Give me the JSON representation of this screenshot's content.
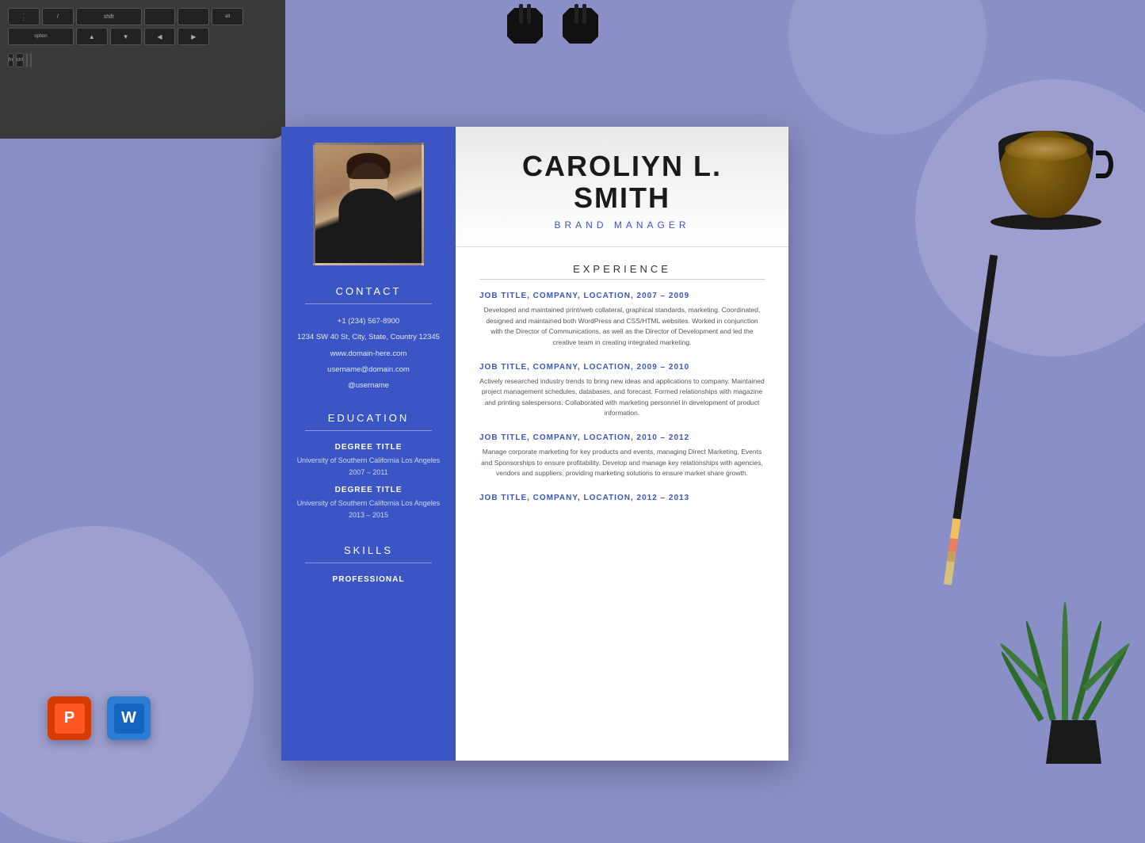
{
  "background": {
    "color": "#8b8fc7"
  },
  "resume": {
    "person": {
      "name_line1": "CAROLIYN L.",
      "name_line2": "SMITH",
      "title": "BRAND MANAGER",
      "photo_alt": "Caroliyn L. Smith profile photo"
    },
    "left_sidebar": {
      "contact_section": {
        "title": "CONTACT",
        "phone": "+1 (234) 567-8900",
        "address": "1234 SW 40 St, City, State, Country 12345",
        "website": "www.domain-here.com",
        "email": "username@domain.com",
        "social": "@username"
      },
      "education_section": {
        "title": "EDUCATION",
        "degrees": [
          {
            "degree": "DEGREE TITLE",
            "university": "University of Southern California Los Angeles",
            "years": "2007 – 2011"
          },
          {
            "degree": "DEGREE TITLE",
            "university": "University of Southern California Los Angeles",
            "years": "2013 – 2015"
          }
        ]
      },
      "skills_section": {
        "title": "SKILLS",
        "subtitle": "PROFESSIONAL"
      }
    },
    "right_content": {
      "experience_section": {
        "title": "EXPERIENCE",
        "jobs": [
          {
            "title": "JOB TITLE, COMPANY, LOCATION, 2007 – 2009",
            "description": "Developed and maintained print/web collateral, graphical standards, marketing. Coordinated, designed and maintained both WordPress and CSS/HTML websites. Worked in conjunction with the Director of Communications, as well as the Director of Development and led the creative team in creating integrated marketing."
          },
          {
            "title": "JOB TITLE, COMPANY, LOCATION, 2009 – 2010",
            "description": "Actively researched industry trends to bring new ideas and applications to company. Maintained project management schedules, databases, and forecast. Formed relationships with magazine and printing salespersons. Collaborated with marketing personnel in development of product information."
          },
          {
            "title": "JOB TITLE, COMPANY, LOCATION, 2010 – 2012",
            "description": "Manage corporate marketing for key products and events, managing Direct Marketing, Events and Sponsorships to ensure profitability. Develop and manage key relationships with agencies, vendors and suppliers, providing marketing solutions to ensure market share growth."
          },
          {
            "title": "JOB TITLE, COMPANY, LOCATION, 2012 – 2013",
            "description": ""
          }
        ]
      }
    }
  },
  "app_icons": {
    "powerpoint": {
      "label": "P",
      "name": "PowerPoint"
    },
    "word": {
      "label": "W",
      "name": "Word"
    }
  },
  "keyboard": {
    "keys": [
      ">",
      "?",
      "shift",
      "alt",
      "option",
      "▲",
      "▼",
      "◀",
      "▶"
    ]
  }
}
